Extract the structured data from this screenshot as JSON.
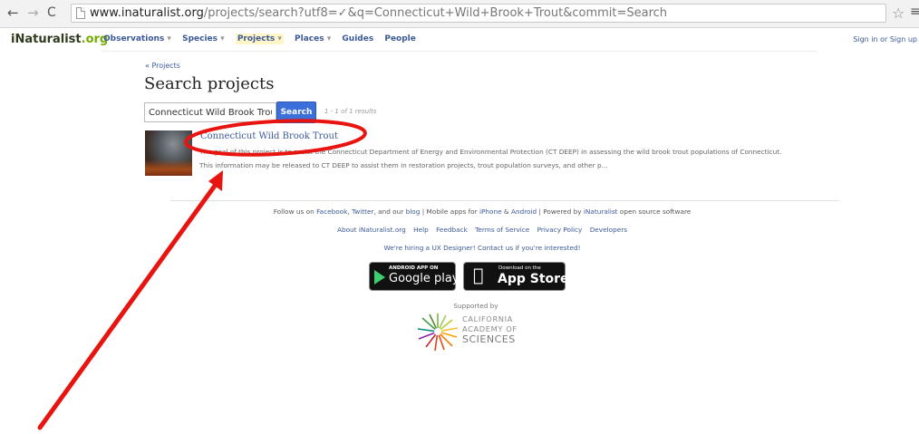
{
  "browser": {
    "url_host": "www.inaturalist.org",
    "url_path": "/projects/search?utf8=✓&q=Connecticut+Wild+Brook+Trout&commit=Search",
    "back_icon": "←",
    "forward_icon": "→",
    "reload_icon": "C",
    "star_icon": "☆",
    "menu_icon": "≡"
  },
  "header": {
    "logo_i": "i",
    "logo_name": "Naturalist",
    "logo_org": ".org",
    "nav": {
      "observations": "Observations",
      "species": "Species",
      "projects": "Projects",
      "places": "Places",
      "guides": "Guides",
      "people": "People"
    },
    "caret": "▾",
    "signin": "Sign in or Sign up"
  },
  "main": {
    "back_link": "« Projects",
    "title": "Search projects",
    "search_value": "Connecticut Wild Brook Trout",
    "search_button": "Search",
    "results_count": "1 - 1 of 1 results",
    "project": {
      "title": "Connecticut Wild Brook Trout",
      "description": "The goal of this project is to assist the Connecticut Department of Energy and Environmental Protection (CT DEEP) in assessing the wild brook trout populations of Connecticut. This information may be released to CT DEEP to assist them in restoration projects, trout population surveys, and other p..."
    }
  },
  "footer": {
    "follow_prefix": "Follow us on",
    "facebook": "Facebook",
    "twitter": "Twitter",
    "and_our": ", and our",
    "blog": "blog",
    "mobile_prefix": "| Mobile apps for",
    "iphone": "iPhone",
    "amp": "&",
    "android": "Android",
    "powered_prefix": "| Powered by",
    "inaturalist": "iNaturalist",
    "powered_suffix": "open source software",
    "links": {
      "about": "About iNaturalist.org",
      "help": "Help",
      "feedback": "Feedback",
      "terms": "Terms of Service",
      "privacy": "Privacy Policy",
      "developers": "Developers"
    },
    "hiring": "We're hiring a UX Designer! Contact us if you're interested!",
    "google_play_small": "ANDROID APP ON",
    "google_play_big": "Google play",
    "app_store_small": "Download on the",
    "app_store_big": "App Store",
    "supported_by": "Supported by",
    "cas_line1": "CALIFORNIA",
    "cas_line2": "ACADEMY OF",
    "cas_line3": "SCIENCES"
  },
  "annotation_color": "#e8140f"
}
